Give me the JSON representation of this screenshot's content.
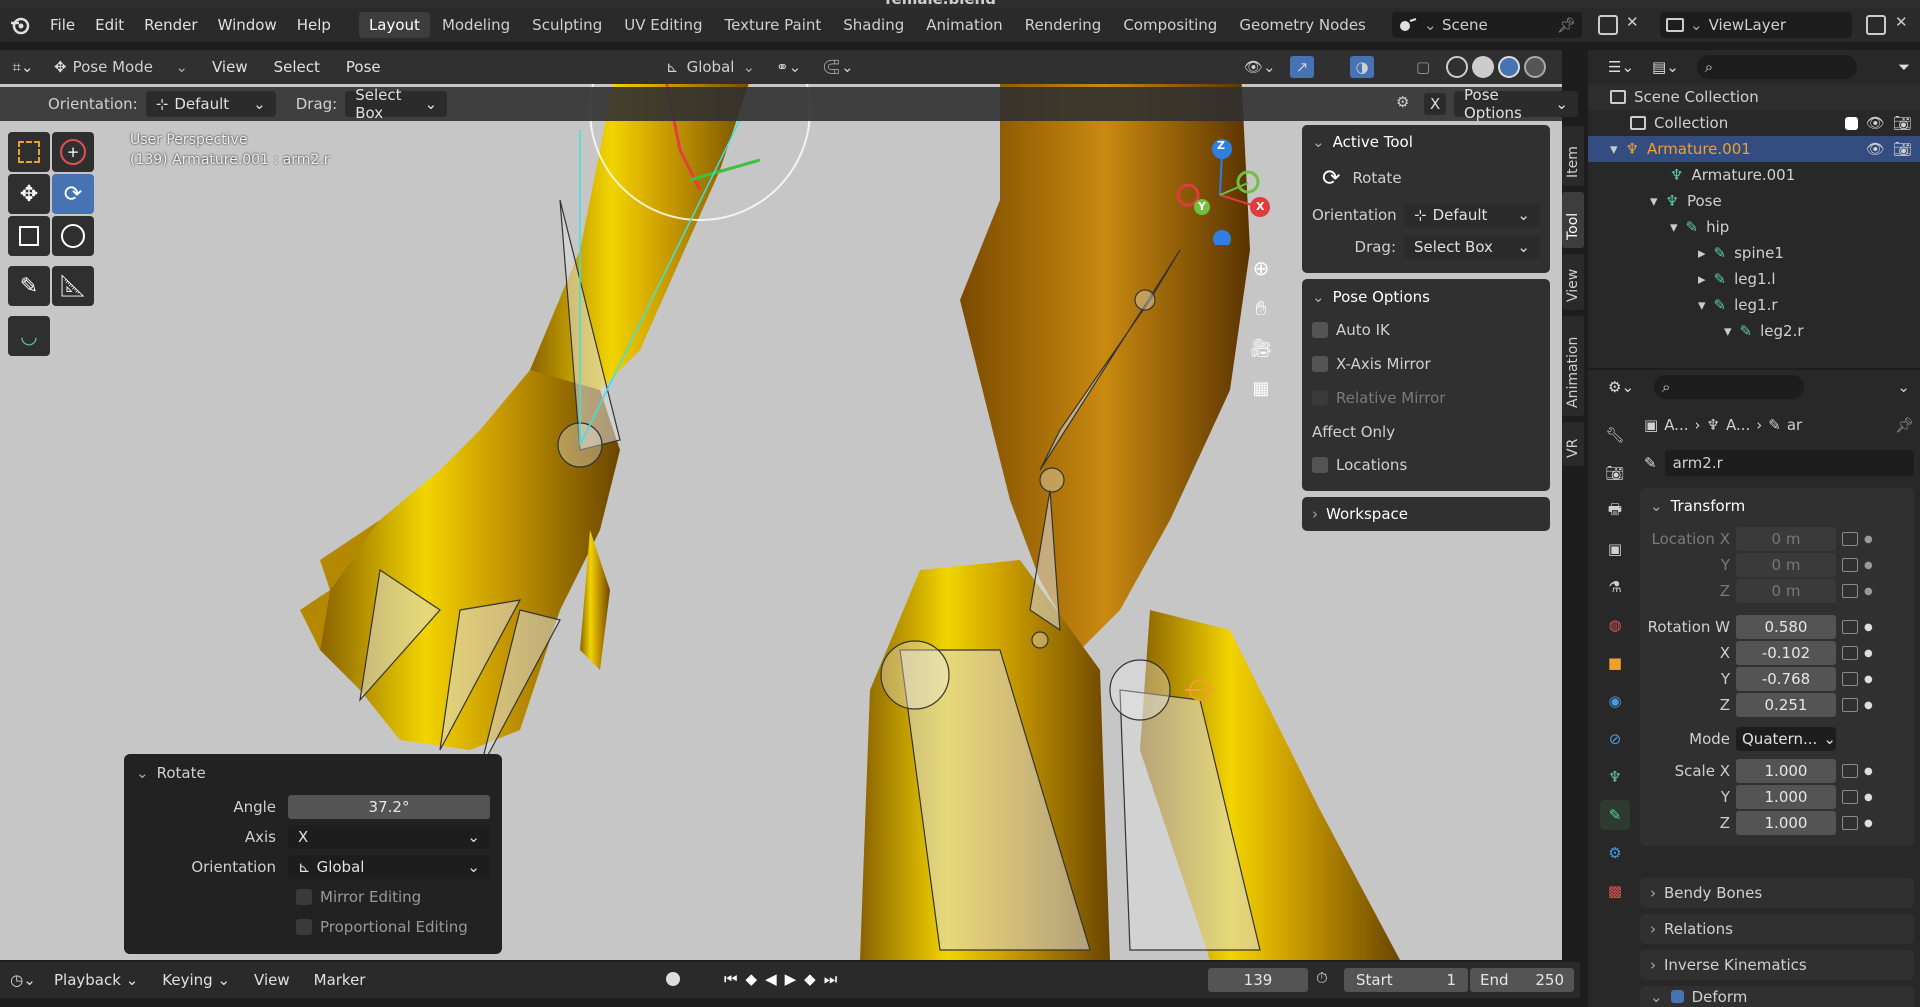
{
  "menubar": {
    "menus": [
      "File",
      "Edit",
      "Render",
      "Window",
      "Help"
    ],
    "workspaces": [
      "Layout",
      "Modeling",
      "Sculpting",
      "UV Editing",
      "Texture Paint",
      "Shading",
      "Animation",
      "Rendering",
      "Compositing",
      "Geometry Nodes"
    ],
    "active_workspace": "Layout",
    "scene": "Scene",
    "view_layer": "ViewLayer"
  },
  "viewport_header": {
    "mode": "Pose Mode",
    "menus": [
      "View",
      "Select",
      "Pose"
    ],
    "transform_orientation": "Global"
  },
  "tool_header": {
    "orientation_label": "Orientation:",
    "orientation_value": "Default",
    "drag_label": "Drag:",
    "drag_value": "Select Box",
    "pose_options": "Pose Options",
    "x_label": "X"
  },
  "viewport": {
    "perspective": "User Perspective",
    "object_info": "(139) Armature.001 : arm2.r",
    "gizmo_axes": [
      "Z",
      "Y",
      "X"
    ]
  },
  "npanel": {
    "tabs": [
      "Item",
      "Tool",
      "View",
      "Animation",
      "VR"
    ],
    "active_tab": "Tool",
    "active_tool": {
      "title": "Active Tool",
      "tool_name": "Rotate",
      "orientation_label": "Orientation",
      "orientation_value": "Default",
      "drag_label": "Drag:",
      "drag_value": "Select Box"
    },
    "pose_options": {
      "title": "Pose Options",
      "auto_ik": "Auto IK",
      "x_axis_mirror": "X-Axis Mirror",
      "relative_mirror": "Relative Mirror",
      "affect_only": "Affect Only",
      "locations": "Locations"
    },
    "workspace": "Workspace"
  },
  "operator_panel": {
    "title": "Rotate",
    "angle_label": "Angle",
    "angle_value": "37.2°",
    "axis_label": "Axis",
    "axis_value": "X",
    "orientation_label": "Orientation",
    "orientation_value": "Global",
    "mirror_editing": "Mirror Editing",
    "proportional_editing": "Proportional Editing"
  },
  "timeline": {
    "menus": [
      "Playback",
      "Keying",
      "View",
      "Marker"
    ],
    "current_frame": "139",
    "start_label": "Start",
    "start_value": "1",
    "end_label": "End",
    "end_value": "250"
  },
  "outliner": {
    "scene_collection": "Scene Collection",
    "items": [
      {
        "label": "Collection",
        "level": 1
      },
      {
        "label": "Armature.001",
        "level": 1,
        "selected": true
      },
      {
        "label": "Armature.001",
        "level": 2
      },
      {
        "label": "Pose",
        "level": 2
      },
      {
        "label": "hip",
        "level": 3
      },
      {
        "label": "spine1",
        "level": 4
      },
      {
        "label": "leg1.l",
        "level": 4
      },
      {
        "label": "leg1.r",
        "level": 4
      },
      {
        "label": "leg2.r",
        "level": 5
      }
    ]
  },
  "properties": {
    "breadcrumb": [
      "A...",
      "A...",
      "ar"
    ],
    "bone_name": "arm2.r",
    "transform": {
      "title": "Transform",
      "location_x_label": "Location X",
      "location_x": "0 m",
      "location_y_label": "Y",
      "location_y": "0 m",
      "location_z_label": "Z",
      "location_z": "0 m",
      "rotation_w_label": "Rotation W",
      "rotation_w": "0.580",
      "rotation_x_label": "X",
      "rotation_x": "-0.102",
      "rotation_y_label": "Y",
      "rotation_y": "-0.768",
      "rotation_z_label": "Z",
      "rotation_z": "0.251",
      "mode_label": "Mode",
      "mode_value": "Quatern...",
      "scale_x_label": "Scale X",
      "scale_x": "1.000",
      "scale_y_label": "Y",
      "scale_y": "1.000",
      "scale_z_label": "Z",
      "scale_z": "1.000"
    },
    "sections": [
      "Bendy Bones",
      "Relations",
      "Inverse Kinematics",
      "Deform"
    ]
  },
  "title_text": "female.blend",
  "colors": {
    "accent": "#4772b3",
    "orange_selected": "#f0a030",
    "viewport_bg": "#c6c6c6",
    "gold": "#d8b000"
  }
}
